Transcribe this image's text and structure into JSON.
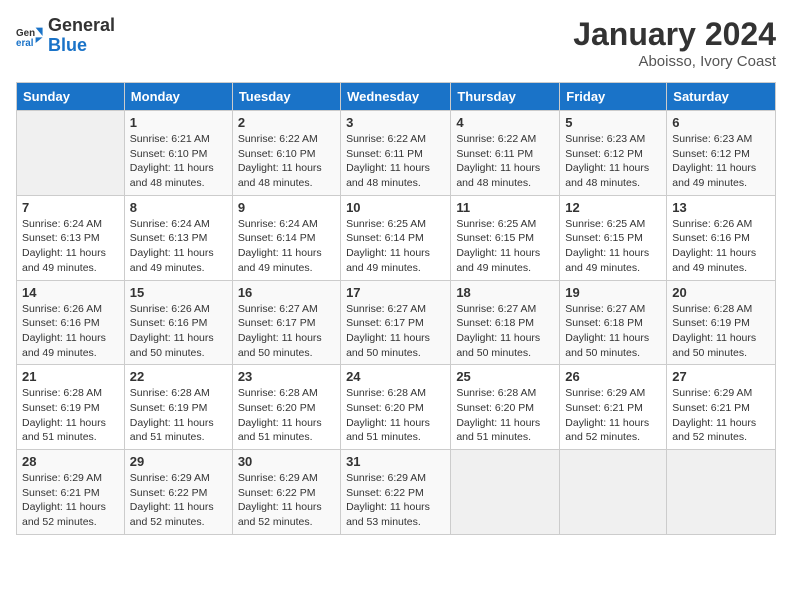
{
  "header": {
    "logo_general": "General",
    "logo_blue": "Blue",
    "month_year": "January 2024",
    "location": "Aboisso, Ivory Coast"
  },
  "days_of_week": [
    "Sunday",
    "Monday",
    "Tuesday",
    "Wednesday",
    "Thursday",
    "Friday",
    "Saturday"
  ],
  "weeks": [
    [
      {
        "day": "",
        "info": ""
      },
      {
        "day": "1",
        "info": "Sunrise: 6:21 AM\nSunset: 6:10 PM\nDaylight: 11 hours and 48 minutes."
      },
      {
        "day": "2",
        "info": "Sunrise: 6:22 AM\nSunset: 6:10 PM\nDaylight: 11 hours and 48 minutes."
      },
      {
        "day": "3",
        "info": "Sunrise: 6:22 AM\nSunset: 6:11 PM\nDaylight: 11 hours and 48 minutes."
      },
      {
        "day": "4",
        "info": "Sunrise: 6:22 AM\nSunset: 6:11 PM\nDaylight: 11 hours and 48 minutes."
      },
      {
        "day": "5",
        "info": "Sunrise: 6:23 AM\nSunset: 6:12 PM\nDaylight: 11 hours and 48 minutes."
      },
      {
        "day": "6",
        "info": "Sunrise: 6:23 AM\nSunset: 6:12 PM\nDaylight: 11 hours and 49 minutes."
      }
    ],
    [
      {
        "day": "7",
        "info": "Sunrise: 6:24 AM\nSunset: 6:13 PM\nDaylight: 11 hours and 49 minutes."
      },
      {
        "day": "8",
        "info": "Sunrise: 6:24 AM\nSunset: 6:13 PM\nDaylight: 11 hours and 49 minutes."
      },
      {
        "day": "9",
        "info": "Sunrise: 6:24 AM\nSunset: 6:14 PM\nDaylight: 11 hours and 49 minutes."
      },
      {
        "day": "10",
        "info": "Sunrise: 6:25 AM\nSunset: 6:14 PM\nDaylight: 11 hours and 49 minutes."
      },
      {
        "day": "11",
        "info": "Sunrise: 6:25 AM\nSunset: 6:15 PM\nDaylight: 11 hours and 49 minutes."
      },
      {
        "day": "12",
        "info": "Sunrise: 6:25 AM\nSunset: 6:15 PM\nDaylight: 11 hours and 49 minutes."
      },
      {
        "day": "13",
        "info": "Sunrise: 6:26 AM\nSunset: 6:16 PM\nDaylight: 11 hours and 49 minutes."
      }
    ],
    [
      {
        "day": "14",
        "info": "Sunrise: 6:26 AM\nSunset: 6:16 PM\nDaylight: 11 hours and 49 minutes."
      },
      {
        "day": "15",
        "info": "Sunrise: 6:26 AM\nSunset: 6:16 PM\nDaylight: 11 hours and 50 minutes."
      },
      {
        "day": "16",
        "info": "Sunrise: 6:27 AM\nSunset: 6:17 PM\nDaylight: 11 hours and 50 minutes."
      },
      {
        "day": "17",
        "info": "Sunrise: 6:27 AM\nSunset: 6:17 PM\nDaylight: 11 hours and 50 minutes."
      },
      {
        "day": "18",
        "info": "Sunrise: 6:27 AM\nSunset: 6:18 PM\nDaylight: 11 hours and 50 minutes."
      },
      {
        "day": "19",
        "info": "Sunrise: 6:27 AM\nSunset: 6:18 PM\nDaylight: 11 hours and 50 minutes."
      },
      {
        "day": "20",
        "info": "Sunrise: 6:28 AM\nSunset: 6:19 PM\nDaylight: 11 hours and 50 minutes."
      }
    ],
    [
      {
        "day": "21",
        "info": "Sunrise: 6:28 AM\nSunset: 6:19 PM\nDaylight: 11 hours and 51 minutes."
      },
      {
        "day": "22",
        "info": "Sunrise: 6:28 AM\nSunset: 6:19 PM\nDaylight: 11 hours and 51 minutes."
      },
      {
        "day": "23",
        "info": "Sunrise: 6:28 AM\nSunset: 6:20 PM\nDaylight: 11 hours and 51 minutes."
      },
      {
        "day": "24",
        "info": "Sunrise: 6:28 AM\nSunset: 6:20 PM\nDaylight: 11 hours and 51 minutes."
      },
      {
        "day": "25",
        "info": "Sunrise: 6:28 AM\nSunset: 6:20 PM\nDaylight: 11 hours and 51 minutes."
      },
      {
        "day": "26",
        "info": "Sunrise: 6:29 AM\nSunset: 6:21 PM\nDaylight: 11 hours and 52 minutes."
      },
      {
        "day": "27",
        "info": "Sunrise: 6:29 AM\nSunset: 6:21 PM\nDaylight: 11 hours and 52 minutes."
      }
    ],
    [
      {
        "day": "28",
        "info": "Sunrise: 6:29 AM\nSunset: 6:21 PM\nDaylight: 11 hours and 52 minutes."
      },
      {
        "day": "29",
        "info": "Sunrise: 6:29 AM\nSunset: 6:22 PM\nDaylight: 11 hours and 52 minutes."
      },
      {
        "day": "30",
        "info": "Sunrise: 6:29 AM\nSunset: 6:22 PM\nDaylight: 11 hours and 52 minutes."
      },
      {
        "day": "31",
        "info": "Sunrise: 6:29 AM\nSunset: 6:22 PM\nDaylight: 11 hours and 53 minutes."
      },
      {
        "day": "",
        "info": ""
      },
      {
        "day": "",
        "info": ""
      },
      {
        "day": "",
        "info": ""
      }
    ]
  ]
}
